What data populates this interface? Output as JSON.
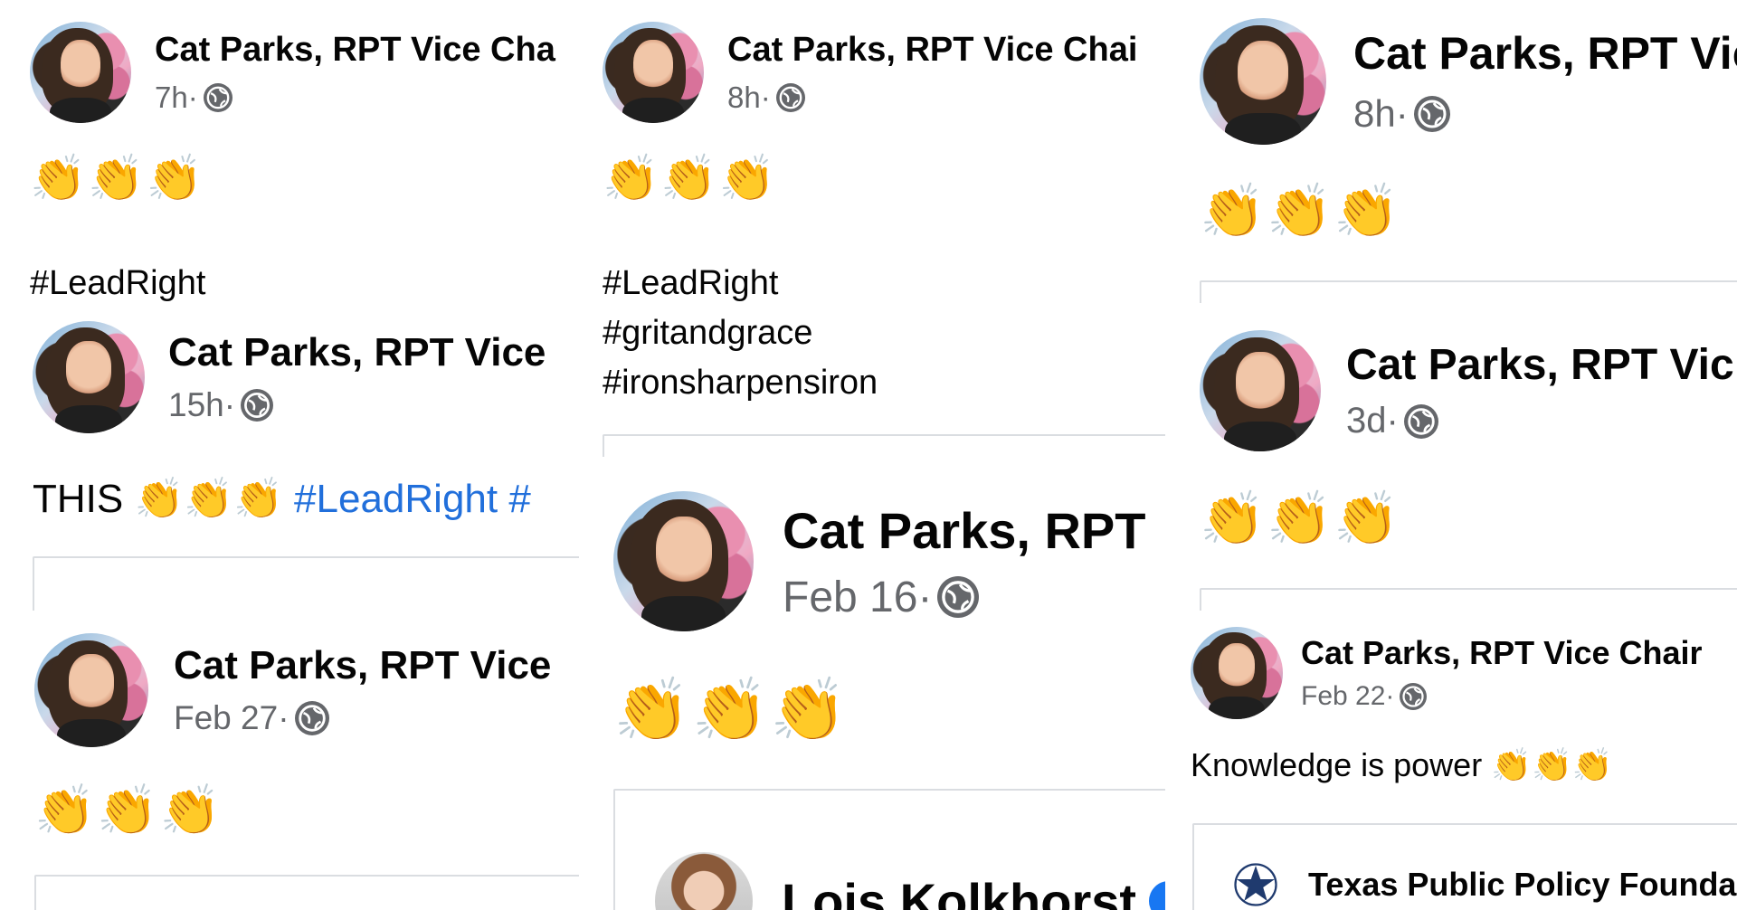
{
  "posts": [
    {
      "author": "Cat Parks, RPT Vice Cha",
      "time": "7h",
      "body": "👏👏👏",
      "hashtags": [
        "#LeadRight"
      ]
    },
    {
      "author": "Cat Parks, RPT Vice Chai",
      "time": "8h",
      "body": "👏👏👏",
      "hashtags": [
        "#LeadRight",
        "#gritandgrace",
        "#ironsharpensiron"
      ]
    },
    {
      "author": "Cat Parks, RPT Vic",
      "time": "8h",
      "body": "👏👏👏"
    },
    {
      "author": "Cat Parks, RPT Vice",
      "time": "15h",
      "text_prefix": "THIS ",
      "body": "👏👏👏",
      "hashtag_inline": " #LeadRight #"
    },
    {
      "author": "Cat Parks, RPT Vic",
      "time": "3d",
      "body": "👏👏👏"
    },
    {
      "author": "Cat Parks, RPT",
      "time": "Feb 16",
      "body": "👏👏👏",
      "shared_author": "Lois Kolkhorst"
    },
    {
      "author": "Cat Parks, RPT Vice",
      "time": "Feb 27",
      "body": "👏👏👏"
    },
    {
      "author": "Cat Parks, RPT Vice Chair",
      "time": "Feb 22",
      "text_prefix": "Knowledge is power ",
      "body": "👏👏👏",
      "shared_author": "Texas Public Policy Founda"
    }
  ],
  "separator": " · ",
  "icons": {
    "privacy": "globe-icon",
    "reaction": "clapping-hands-emoji",
    "verified": "verified-badge-icon",
    "org_logo": "star-logo-icon"
  },
  "colors": {
    "name": "#050505",
    "meta": "#65676b",
    "hashtag": "#216fdb",
    "divider": "#dadde1"
  }
}
